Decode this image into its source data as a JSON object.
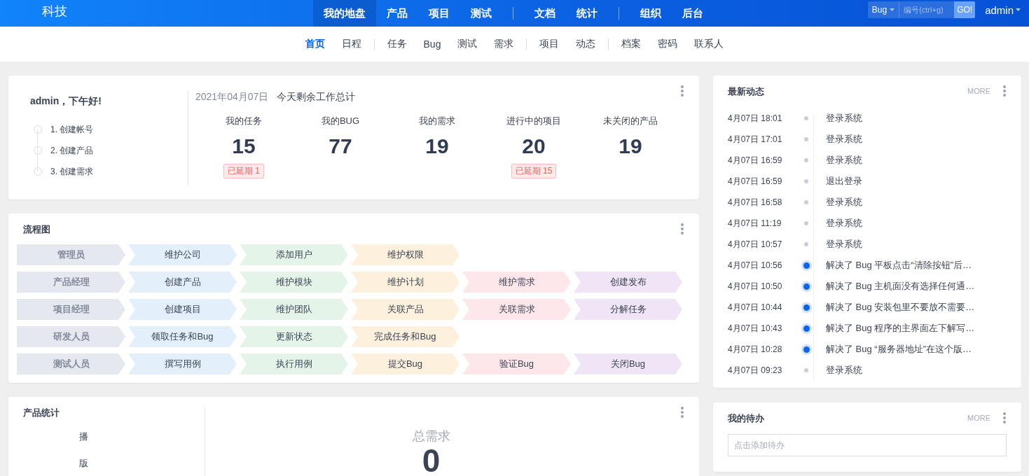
{
  "header": {
    "logo": "科技",
    "nav_groups": [
      [
        {
          "label": "我的地盘",
          "selected": true
        },
        {
          "label": "产品",
          "selected": false
        },
        {
          "label": "项目",
          "selected": false
        },
        {
          "label": "测试",
          "selected": false
        }
      ],
      [
        {
          "label": "文档",
          "selected": false
        },
        {
          "label": "统计",
          "selected": false
        }
      ],
      [
        {
          "label": "组织",
          "selected": false
        },
        {
          "label": "后台",
          "selected": false
        }
      ]
    ],
    "search": {
      "type": "Bug",
      "placeholder": "编号(ctrl+g)",
      "button": "GO!"
    },
    "user": "admin"
  },
  "subnav_groups": [
    [
      {
        "label": "首页",
        "selected": true
      },
      {
        "label": "日程",
        "selected": false
      }
    ],
    [
      {
        "label": "任务",
        "selected": false
      },
      {
        "label": "Bug",
        "selected": false
      },
      {
        "label": "测试",
        "selected": false
      },
      {
        "label": "需求",
        "selected": false
      }
    ],
    [
      {
        "label": "项目",
        "selected": false
      },
      {
        "label": "动态",
        "selected": false
      }
    ],
    [
      {
        "label": "档案",
        "selected": false
      },
      {
        "label": "密码",
        "selected": false
      },
      {
        "label": "联系人",
        "selected": false
      }
    ]
  ],
  "welcome": {
    "greeting": "admin，下午好!",
    "steps": [
      "1. 创建帐号",
      "2. 创建产品",
      "3. 创建需求"
    ],
    "date": "2021年04月07日",
    "summary_title": "今天剩余工作总计",
    "stats": [
      {
        "label": "我的任务",
        "value": "15",
        "badge": "已延期 1"
      },
      {
        "label": "我的BUG",
        "value": "77"
      },
      {
        "label": "我的需求",
        "value": "19"
      },
      {
        "label": "进行中的项目",
        "value": "20",
        "badge": "已延期 15"
      },
      {
        "label": "未关闭的产品",
        "value": "19"
      }
    ]
  },
  "flowchart": {
    "title": "流程图",
    "rows": [
      {
        "role": "管理员",
        "steps": [
          "维护公司",
          "添加用户",
          "维护权限"
        ]
      },
      {
        "role": "产品经理",
        "steps": [
          "创建产品",
          "维护模块",
          "维护计划",
          "维护需求",
          "创建发布"
        ]
      },
      {
        "role": "项目经理",
        "steps": [
          "创建项目",
          "维护团队",
          "关联产品",
          "关联需求",
          "分解任务"
        ]
      },
      {
        "role": "研发人员",
        "steps": [
          "领取任务和Bug",
          "更新状态",
          "完成任务和Bug"
        ]
      },
      {
        "role": "测试人员",
        "steps": [
          "撰写用例",
          "执行用例",
          "提交Bug",
          "验证Bug",
          "关闭Bug"
        ]
      }
    ]
  },
  "product_stats": {
    "title": "产品统计",
    "products": [
      "播",
      "版"
    ],
    "total_label": "总需求",
    "total_value": "0"
  },
  "activity": {
    "title": "最新动态",
    "more": "MORE",
    "entries": [
      {
        "time": "4月07日 18:01",
        "text": "登录系统",
        "kind": "normal"
      },
      {
        "time": "4月07日 17:01",
        "text": "登录系统",
        "kind": "normal"
      },
      {
        "time": "4月07日 16:59",
        "text": "登录系统",
        "kind": "normal"
      },
      {
        "time": "4月07日 16:59",
        "text": "退出登录",
        "kind": "normal"
      },
      {
        "time": "4月07日 16:58",
        "text": "登录系统",
        "kind": "normal"
      },
      {
        "time": "4月07日 11:19",
        "text": "登录系统",
        "kind": "normal"
      },
      {
        "time": "4月07日 10:57",
        "text": "登录系统",
        "kind": "normal"
      },
      {
        "time": "4月07日 10:56",
        "text": "解决了 Bug 平板点击“清除按钮”后…",
        "kind": "bug"
      },
      {
        "time": "4月07日 10:50",
        "text": "解决了 Bug 主机面没有选择任何通…",
        "kind": "bug"
      },
      {
        "time": "4月07日 10:44",
        "text": "解决了 Bug 安装包里不要放不需要…",
        "kind": "bug"
      },
      {
        "time": "4月07日 10:43",
        "text": "解决了 Bug 程序的主界面左下解写…",
        "kind": "bug"
      },
      {
        "time": "4月07日 10:28",
        "text": "解决了 Bug “服务器地址”在这个版…",
        "kind": "bug"
      },
      {
        "time": "4月07日 09:23",
        "text": "登录系统",
        "kind": "normal"
      }
    ]
  },
  "todo": {
    "title": "我的待办",
    "more": "MORE",
    "placeholder": "点击添加待办"
  }
}
